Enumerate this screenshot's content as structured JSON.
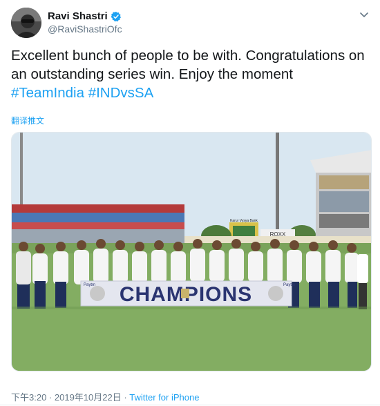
{
  "author": {
    "display_name": "Ravi Shastri",
    "handle": "@RaviShastriOfc"
  },
  "tweet": {
    "text": "Excellent bunch of people to be with. Congratulations on an outstanding series win. Enjoy the moment",
    "hashtags": [
      "#TeamIndia",
      "#INDvsSA"
    ],
    "translate_label": "翻译推文"
  },
  "photo": {
    "banner_text": "CHAMPIONS",
    "sponsor_text": "Paytm",
    "screen_text": "Karur Vysya Bank",
    "board_text": "ROXX"
  },
  "meta": {
    "time": "下午3:20",
    "separator1": " · ",
    "date": "2019年10月22日",
    "separator2": " · ",
    "source": "Twitter for iPhone"
  },
  "colors": {
    "accent": "#1da1f2",
    "secondary_text": "#657786",
    "field_green": "#7fa85a",
    "sky": "#d7e6f0"
  },
  "icons": {
    "verified": "verified-badge-icon",
    "more": "chevron-down-icon"
  }
}
